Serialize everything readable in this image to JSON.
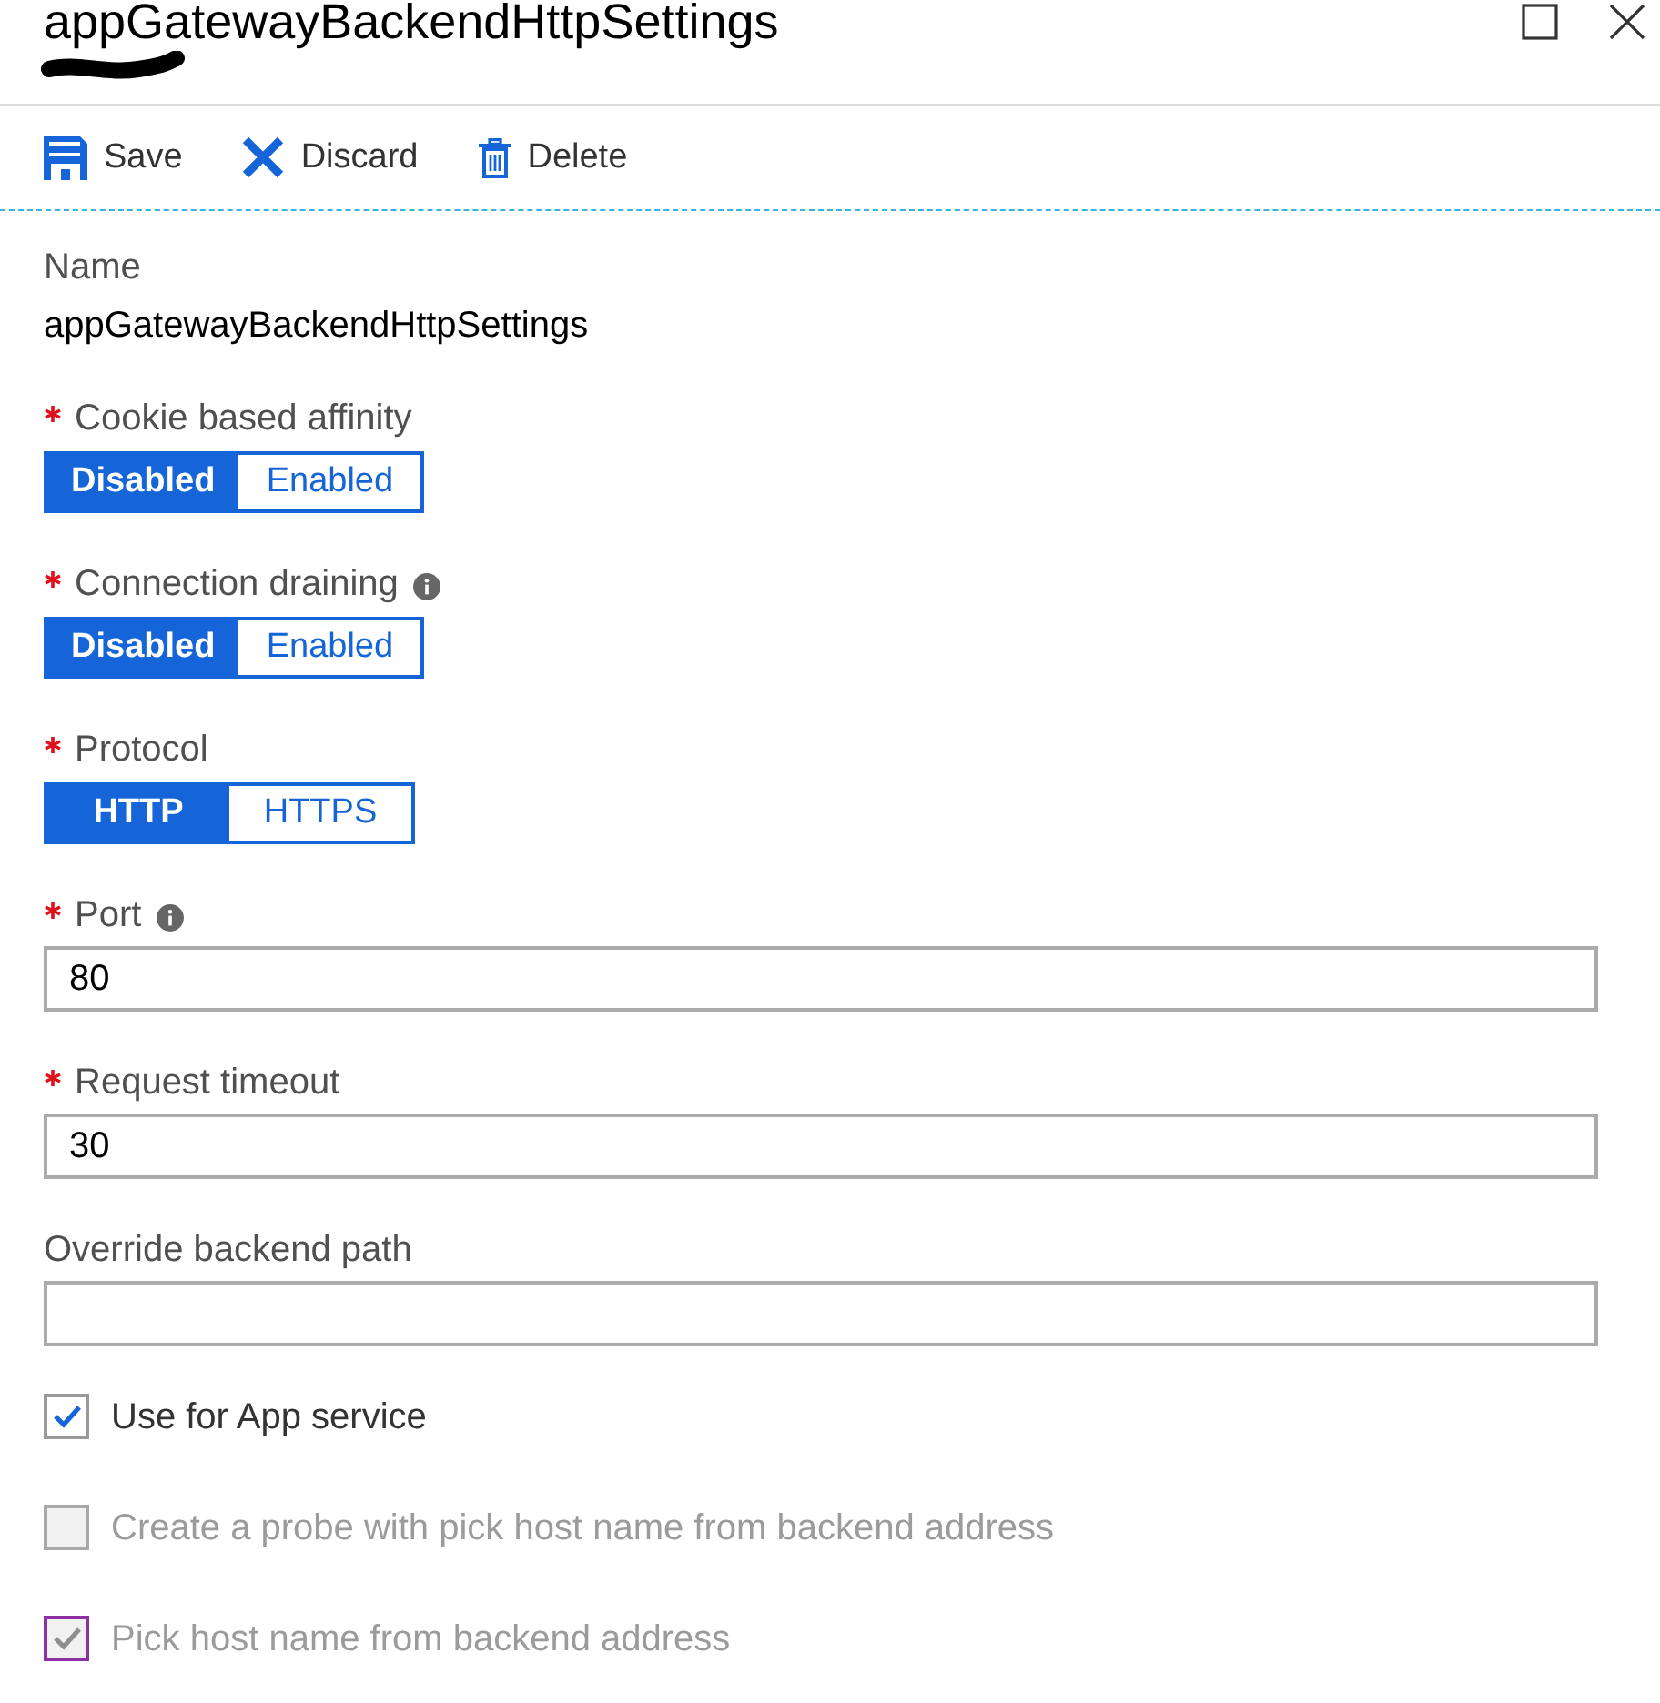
{
  "window": {
    "title": "appGatewayBackendHttpSettings"
  },
  "toolbar": [
    {
      "kind": "save",
      "label": "Save"
    },
    {
      "kind": "discard",
      "label": "Discard"
    },
    {
      "kind": "delete",
      "label": "Delete"
    }
  ],
  "fields": [
    {
      "kind": "readonly",
      "label": "Name",
      "required": false,
      "info": false,
      "value": "appGatewayBackendHttpSettings"
    },
    {
      "kind": "toggle",
      "label": "Cookie based affinity",
      "required": true,
      "info": false,
      "options": [
        {
          "label": "Disabled",
          "selected": true
        },
        {
          "label": "Enabled",
          "selected": false
        }
      ]
    },
    {
      "kind": "toggle",
      "label": "Connection draining",
      "required": true,
      "info": true,
      "options": [
        {
          "label": "Disabled",
          "selected": true
        },
        {
          "label": "Enabled",
          "selected": false
        }
      ]
    },
    {
      "kind": "toggle",
      "label": "Protocol",
      "required": true,
      "info": false,
      "options": [
        {
          "label": "HTTP",
          "selected": true
        },
        {
          "label": "HTTPS",
          "selected": false
        }
      ]
    },
    {
      "kind": "text",
      "label": "Port",
      "required": true,
      "info": true,
      "value": "80"
    },
    {
      "kind": "text",
      "label": "Request timeout",
      "required": true,
      "info": false,
      "value": "30"
    },
    {
      "kind": "text",
      "label": "Override backend path",
      "required": false,
      "info": false
    }
  ],
  "checkboxes": [
    {
      "label": "Use for App service",
      "checked": true,
      "disabled": false,
      "focused": false
    },
    {
      "label": "Create a probe with pick host name from backend address",
      "checked": false,
      "disabled": true,
      "focused": false
    },
    {
      "label": "Pick host name from backend address",
      "checked": true,
      "disabled": true,
      "focused": true
    }
  ]
}
